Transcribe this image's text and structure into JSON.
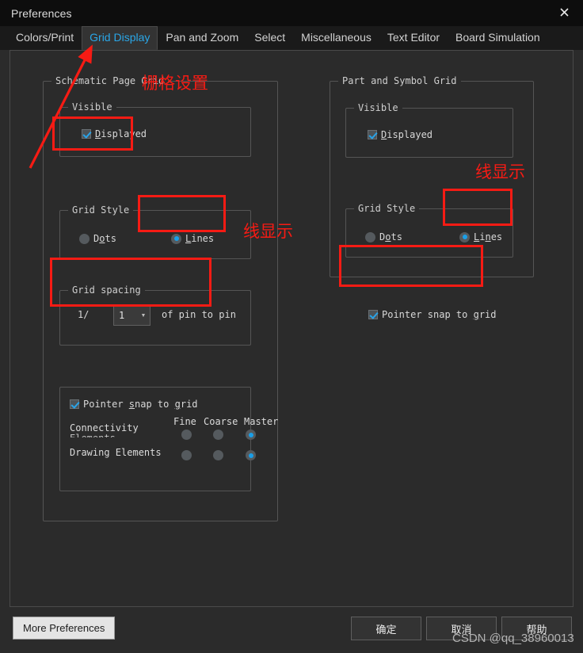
{
  "window": {
    "title": "Preferences",
    "close_icon": "close-icon"
  },
  "tabs": [
    {
      "label": "Colors/Print",
      "active": false
    },
    {
      "label": "Grid Display",
      "active": true
    },
    {
      "label": "Pan and Zoom",
      "active": false
    },
    {
      "label": "Select",
      "active": false
    },
    {
      "label": "Miscellaneous",
      "active": false
    },
    {
      "label": "Text Editor",
      "active": false
    },
    {
      "label": "Board Simulation",
      "active": false
    }
  ],
  "schematic_page_grid": {
    "legend": "Schematic Page Grid",
    "visible": {
      "legend": "Visible",
      "displayed_label": "Displayed",
      "displayed_checked": true
    },
    "grid_style": {
      "legend": "Grid Style",
      "dots_label": "Dots",
      "lines_label": "Lines",
      "selected": "Lines"
    },
    "grid_spacing": {
      "legend": "Grid spacing",
      "numerator": "1/",
      "divisor_value": "1",
      "suffix_label": "of pin to pin"
    },
    "snap": {
      "pointer_snap_label": "Pointer snap to grid",
      "pointer_snap_checked": true,
      "columns": [
        "Fine",
        "Coarse",
        "Master"
      ],
      "rows": [
        {
          "label": "Connectivity",
          "sublabel": "Elements",
          "selected": "Master"
        },
        {
          "label": "Drawing Elements",
          "sublabel": "",
          "selected": "Master"
        }
      ]
    }
  },
  "part_and_symbol_grid": {
    "legend": "Part and Symbol Grid",
    "visible": {
      "legend": "Visible",
      "displayed_label": "Displayed",
      "displayed_checked": true
    },
    "grid_style": {
      "legend": "Grid Style",
      "dots_label": "Dots",
      "lines_label": "Lines",
      "selected": "Lines"
    },
    "pointer_snap_label": "Pointer snap to grid",
    "pointer_snap_checked": true
  },
  "footer": {
    "more_preferences": "More Preferences",
    "ok": "确定",
    "cancel": "取消",
    "help": "帮助"
  },
  "annotations": {
    "grid_settings_cn": "栅格设置",
    "line_display_left_cn": "线显示",
    "line_display_right_cn": "线显示",
    "accent_color": "#f61b14"
  },
  "watermark": {
    "text": "CSDN @qq_38960013"
  }
}
